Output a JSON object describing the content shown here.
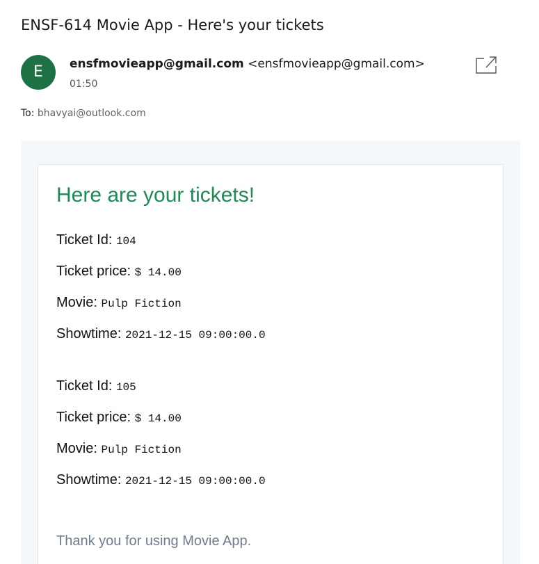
{
  "email": {
    "subject": "ENSF-614 Movie App - Here's your tickets",
    "sender": {
      "avatar_letter": "E",
      "name": "ensfmovieapp@gmail.com",
      "address": "<ensfmovieapp@gmail.com>",
      "time": "01:50"
    },
    "to_label": "To:",
    "to_address": "bhavyai@outlook.com",
    "open_in_new_window_icon": "open-in-new-window-icon"
  },
  "body": {
    "heading": "Here are your tickets!",
    "labels": {
      "ticket_id": "Ticket Id:",
      "ticket_price": "Ticket price:",
      "movie": "Movie:",
      "showtime": "Showtime:"
    },
    "tickets": [
      {
        "id": "104",
        "price": "$ 14.00",
        "movie": "Pulp Fiction",
        "showtime": "2021-12-15 09:00:00.0"
      },
      {
        "id": "105",
        "price": "$ 14.00",
        "movie": "Pulp Fiction",
        "showtime": "2021-12-15 09:00:00.0"
      }
    ],
    "footer": "Thank you for using Movie App."
  },
  "colors": {
    "avatar_bg": "#1e7145",
    "heading": "#1e8a55",
    "footer_text": "#6f7c8c",
    "mail_background": "#f5f8fb"
  }
}
